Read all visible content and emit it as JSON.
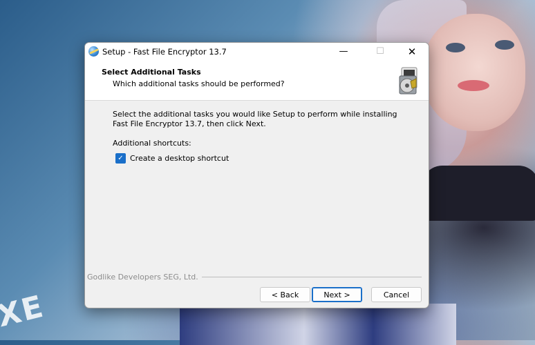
{
  "dialog": {
    "title": "Setup - Fast File Encryptor 13.7",
    "window_controls": {
      "minimize": "—",
      "maximize": "☐",
      "close": "✕"
    }
  },
  "header": {
    "title": "Select Additional Tasks",
    "subtitle": "Which additional tasks should be performed?",
    "icon": "installer-box-icon"
  },
  "content": {
    "description": "Select the additional tasks you would like Setup to perform while installing Fast File Encryptor 13.7, then click Next.",
    "group_label": "Additional shortcuts:",
    "tasks": [
      {
        "label": "Create a desktop shortcut",
        "checked": true
      }
    ]
  },
  "branding": "Godlike Developers SEG, Ltd.",
  "buttons": {
    "back": "< Back",
    "next": "Next >",
    "cancel": "Cancel"
  },
  "desktop": {
    "watermark": "XE"
  },
  "colors": {
    "accent": "#1a6fc9"
  }
}
